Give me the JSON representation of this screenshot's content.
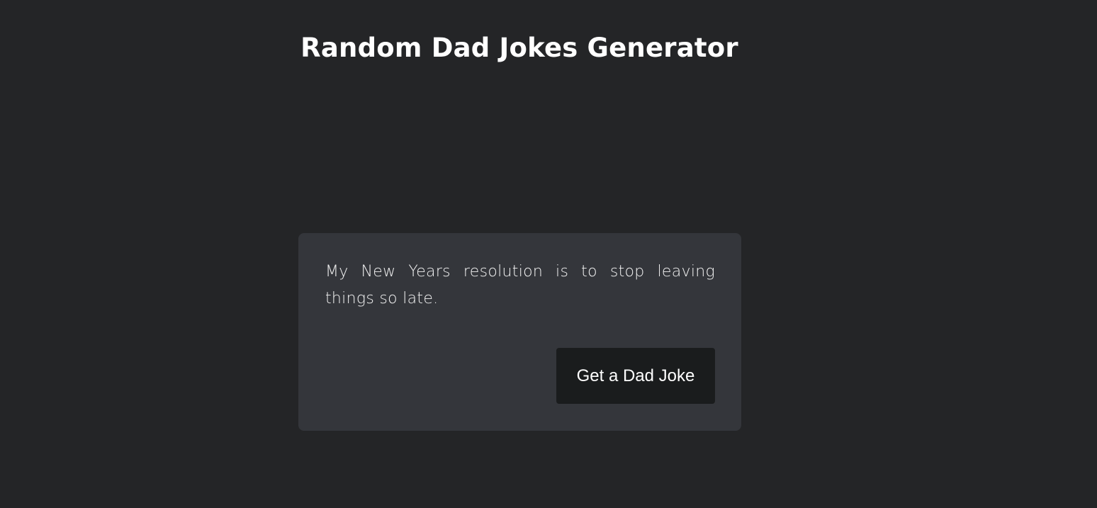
{
  "header": {
    "title": "Random Dad Jokes Generator"
  },
  "joke": {
    "text": "My New Years resolution is to stop leaving things so late."
  },
  "actions": {
    "get_joke_label": "Get a Dad Joke"
  },
  "colors": {
    "background": "#242527",
    "card": "#34363b",
    "button": "#1a1c1d",
    "text": "#ffffff"
  }
}
